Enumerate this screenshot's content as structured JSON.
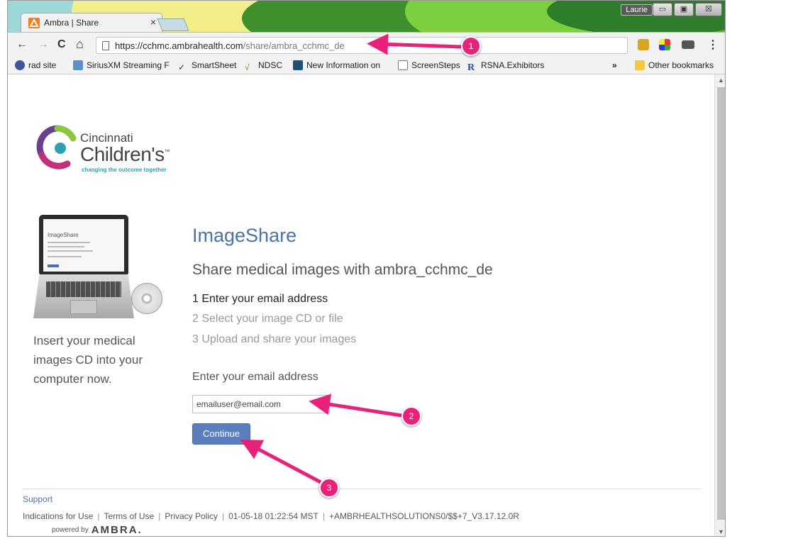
{
  "browser": {
    "tab_title": "Ambra | Share",
    "tab_close": "×",
    "user_name": "Laurie",
    "minimize": "▭",
    "maximize": "▣",
    "close": "☒",
    "back": "←",
    "forward": "→",
    "reload": "C",
    "home": "⌂",
    "url_host": "https://cchmc.ambrahealth.com",
    "url_path": "/share/ambra_cchmc_de",
    "menu": "⋮"
  },
  "bookmarks": {
    "items": [
      {
        "label": "rad site",
        "icon": "rad-site-icon",
        "color": "#3b5998"
      },
      {
        "label": "SiriusXM Streaming F",
        "icon": "siriusxm-icon",
        "color": "#5a8fc8"
      },
      {
        "label": "SmartSheet",
        "icon": "check-icon",
        "color": "#3c3c3c"
      },
      {
        "label": "NDSC",
        "icon": "ndsc-icon",
        "color": "#6b8e23"
      },
      {
        "label": "New Information on",
        "icon": "book-icon",
        "color": "#1f4e79"
      },
      {
        "label": "ScreenSteps",
        "icon": "page-icon",
        "color": "#777777"
      },
      {
        "label": "RSNA.Exhibitors",
        "icon": "rsna-icon",
        "color": "#2c4e9b"
      }
    ],
    "overflow": "»",
    "other": "Other bookmarks"
  },
  "logo": {
    "line1": "Cincinnati",
    "line2": "Children's",
    "tagline": "changing the outcome together",
    "tm": "™"
  },
  "laptop": {
    "screen_title": "ImageShare"
  },
  "sidebar": {
    "instruction": "Insert your medical images CD into your computer now."
  },
  "main": {
    "title": "ImageShare",
    "subtitle": "Share medical images with ambra_cchmc_de",
    "steps": [
      "1 Enter your email address",
      "2 Select your image CD or file",
      "3 Upload and share your images"
    ],
    "email_label": "Enter your email address",
    "email_value": "emailuser@email.com",
    "continue_label": "Continue"
  },
  "footer": {
    "support": "Support",
    "links": [
      "Indications for Use",
      "Terms of Use",
      "Privacy Policy"
    ],
    "timestamp": "01-05-18 01:22:54 MST",
    "build": "+AMBRHEALTHSOLUTIONS0/$$+7_V3.17.12.0R",
    "powered_by": "powered by",
    "brand": "AMBRA."
  },
  "annotations": {
    "markers": [
      "1",
      "2",
      "3"
    ],
    "color": "#e8217b"
  },
  "colors": {
    "heading_blue": "#4a73a8",
    "button_blue": "#5b7fbe",
    "chrome_green": "#5fae3a"
  }
}
